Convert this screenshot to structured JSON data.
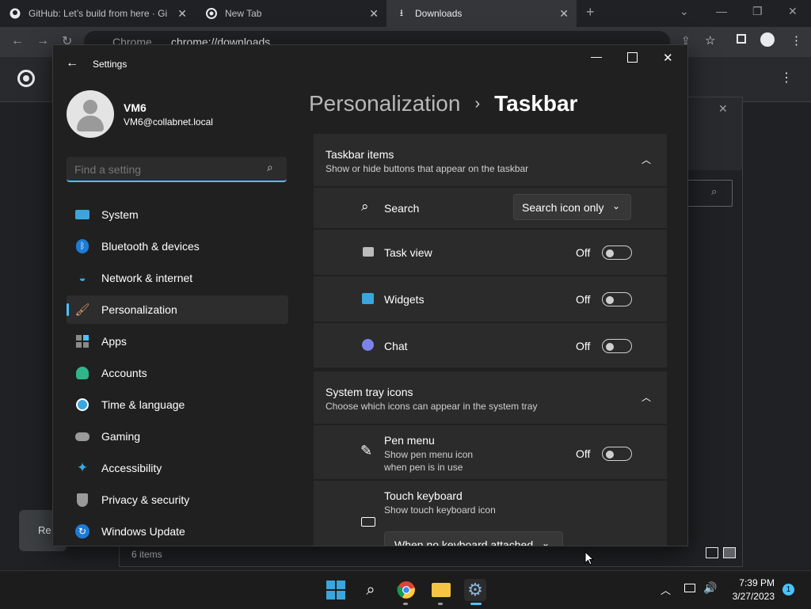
{
  "browser": {
    "tabs": [
      {
        "title": "GitHub: Let’s build from here · Gi"
      },
      {
        "title": "New Tab"
      },
      {
        "title": "Downloads"
      }
    ],
    "address_label": "Chrome",
    "address_url": "chrome://downloads"
  },
  "background": {
    "remove_partial": "Re",
    "items_count": "6 items"
  },
  "settings": {
    "window_title": "Settings",
    "user": {
      "name": "VM6",
      "email": "VM6@collabnet.local"
    },
    "search_placeholder": "Find a setting",
    "nav": [
      {
        "label": "System",
        "icon": "system-icon"
      },
      {
        "label": "Bluetooth & devices",
        "icon": "bluetooth-icon"
      },
      {
        "label": "Network & internet",
        "icon": "wifi-icon"
      },
      {
        "label": "Personalization",
        "icon": "brush-icon"
      },
      {
        "label": "Apps",
        "icon": "apps-icon"
      },
      {
        "label": "Accounts",
        "icon": "accounts-icon"
      },
      {
        "label": "Time & language",
        "icon": "clock-globe-icon"
      },
      {
        "label": "Gaming",
        "icon": "gamepad-icon"
      },
      {
        "label": "Accessibility",
        "icon": "accessibility-icon"
      },
      {
        "label": "Privacy & security",
        "icon": "shield-icon"
      },
      {
        "label": "Windows Update",
        "icon": "update-icon"
      }
    ],
    "breadcrumb": {
      "parent": "Personalization",
      "separator": "›",
      "current": "Taskbar"
    },
    "taskbar_items": {
      "title": "Taskbar items",
      "subtitle": "Show or hide buttons that appear on the taskbar",
      "rows": [
        {
          "label": "Search",
          "control": "dropdown",
          "value": "Search icon only"
        },
        {
          "label": "Task view",
          "state": "Off"
        },
        {
          "label": "Widgets",
          "state": "Off"
        },
        {
          "label": "Chat",
          "state": "Off"
        }
      ]
    },
    "system_tray": {
      "title": "System tray icons",
      "subtitle": "Choose which icons can appear in the system tray",
      "pen": {
        "label": "Pen menu",
        "sub1": "Show pen menu icon",
        "sub2": "when pen is in use",
        "state": "Off"
      },
      "keyboard": {
        "label": "Touch keyboard",
        "sub": "Show touch keyboard icon",
        "value": "When no keyboard attached"
      }
    }
  },
  "taskbar": {
    "time": "7:39 PM",
    "date": "3/27/2023",
    "notification_count": "1"
  },
  "colors": {
    "accent": "#4cc2ff",
    "bg": "#202020",
    "card": "#2b2b2b"
  }
}
